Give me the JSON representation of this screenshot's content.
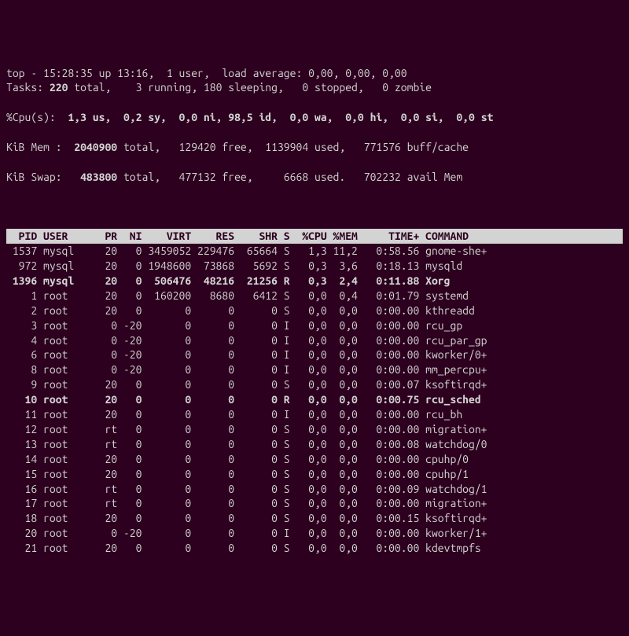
{
  "summary": {
    "line1": "top - 15:28:35 up 13:16,  1 user,  load average: 0,00, 0,00, 0,00",
    "tasks_label": "Tasks:",
    "tasks_rest": " total,    3 running, 180 sleeping,   0 stopped,   0 zombie",
    "tasks_total": " 220",
    "cpu_label": "%Cpu(s):",
    "cpu_vals": "  1,3 us,  0,2 sy,  0,0 ni, 98,5 id,  0,0 wa,  0,0 hi,  0,0 si,  0,0 st",
    "mem_label": "KiB Mem :",
    "mem_total": "  2040900 ",
    "mem_rest1": "total,   129420 free,  1139904 used,   771576 buff/cache",
    "swap_label": "KiB Swap:",
    "swap_total": "   483800 ",
    "swap_rest1": "total,   477132 free,     6668 used.   702232 avail Mem"
  },
  "columns": [
    "PID",
    "USER",
    "PR",
    "NI",
    "VIRT",
    "RES",
    "SHR",
    "S",
    "%CPU",
    "%MEM",
    "TIME+",
    "COMMAND"
  ],
  "header_line": "  PID USER      PR  NI    VIRT    RES    SHR S  %CPU %MEM     TIME+ COMMAND   ",
  "rows": [
    {
      "bold": false,
      "pid": "1537",
      "user": "mysql",
      "pr": "20",
      "ni": "0",
      "virt": "3459052",
      "res": "229476",
      "shr": "65664",
      "s": "S",
      "cpu": "1,3",
      "mem": "11,2",
      "time": "0:58.56",
      "cmd": "gnome-she+"
    },
    {
      "bold": false,
      "pid": "972",
      "user": "mysql",
      "pr": "20",
      "ni": "0",
      "virt": "1948600",
      "res": "73868",
      "shr": "5692",
      "s": "S",
      "cpu": "0,3",
      "mem": "3,6",
      "time": "0:18.13",
      "cmd": "mysqld"
    },
    {
      "bold": true,
      "pid": "1396",
      "user": "mysql",
      "pr": "20",
      "ni": "0",
      "virt": "506476",
      "res": "48216",
      "shr": "21256",
      "s": "R",
      "cpu": "0,3",
      "mem": "2,4",
      "time": "0:11.88",
      "cmd": "Xorg"
    },
    {
      "bold": false,
      "pid": "1",
      "user": "root",
      "pr": "20",
      "ni": "0",
      "virt": "160200",
      "res": "8680",
      "shr": "6412",
      "s": "S",
      "cpu": "0,0",
      "mem": "0,4",
      "time": "0:01.79",
      "cmd": "systemd"
    },
    {
      "bold": false,
      "pid": "2",
      "user": "root",
      "pr": "20",
      "ni": "0",
      "virt": "0",
      "res": "0",
      "shr": "0",
      "s": "S",
      "cpu": "0,0",
      "mem": "0,0",
      "time": "0:00.00",
      "cmd": "kthreadd"
    },
    {
      "bold": false,
      "pid": "3",
      "user": "root",
      "pr": "0",
      "ni": "-20",
      "virt": "0",
      "res": "0",
      "shr": "0",
      "s": "I",
      "cpu": "0,0",
      "mem": "0,0",
      "time": "0:00.00",
      "cmd": "rcu_gp"
    },
    {
      "bold": false,
      "pid": "4",
      "user": "root",
      "pr": "0",
      "ni": "-20",
      "virt": "0",
      "res": "0",
      "shr": "0",
      "s": "I",
      "cpu": "0,0",
      "mem": "0,0",
      "time": "0:00.00",
      "cmd": "rcu_par_gp"
    },
    {
      "bold": false,
      "pid": "6",
      "user": "root",
      "pr": "0",
      "ni": "-20",
      "virt": "0",
      "res": "0",
      "shr": "0",
      "s": "I",
      "cpu": "0,0",
      "mem": "0,0",
      "time": "0:00.00",
      "cmd": "kworker/0+"
    },
    {
      "bold": false,
      "pid": "8",
      "user": "root",
      "pr": "0",
      "ni": "-20",
      "virt": "0",
      "res": "0",
      "shr": "0",
      "s": "I",
      "cpu": "0,0",
      "mem": "0,0",
      "time": "0:00.00",
      "cmd": "mm_percpu+"
    },
    {
      "bold": false,
      "pid": "9",
      "user": "root",
      "pr": "20",
      "ni": "0",
      "virt": "0",
      "res": "0",
      "shr": "0",
      "s": "S",
      "cpu": "0,0",
      "mem": "0,0",
      "time": "0:00.07",
      "cmd": "ksoftirqd+"
    },
    {
      "bold": true,
      "pid": "10",
      "user": "root",
      "pr": "20",
      "ni": "0",
      "virt": "0",
      "res": "0",
      "shr": "0",
      "s": "R",
      "cpu": "0,0",
      "mem": "0,0",
      "time": "0:00.75",
      "cmd": "rcu_sched"
    },
    {
      "bold": false,
      "pid": "11",
      "user": "root",
      "pr": "20",
      "ni": "0",
      "virt": "0",
      "res": "0",
      "shr": "0",
      "s": "I",
      "cpu": "0,0",
      "mem": "0,0",
      "time": "0:00.00",
      "cmd": "rcu_bh"
    },
    {
      "bold": false,
      "pid": "12",
      "user": "root",
      "pr": "rt",
      "ni": "0",
      "virt": "0",
      "res": "0",
      "shr": "0",
      "s": "S",
      "cpu": "0,0",
      "mem": "0,0",
      "time": "0:00.00",
      "cmd": "migration+"
    },
    {
      "bold": false,
      "pid": "13",
      "user": "root",
      "pr": "rt",
      "ni": "0",
      "virt": "0",
      "res": "0",
      "shr": "0",
      "s": "S",
      "cpu": "0,0",
      "mem": "0,0",
      "time": "0:00.08",
      "cmd": "watchdog/0"
    },
    {
      "bold": false,
      "pid": "14",
      "user": "root",
      "pr": "20",
      "ni": "0",
      "virt": "0",
      "res": "0",
      "shr": "0",
      "s": "S",
      "cpu": "0,0",
      "mem": "0,0",
      "time": "0:00.00",
      "cmd": "cpuhp/0"
    },
    {
      "bold": false,
      "pid": "15",
      "user": "root",
      "pr": "20",
      "ni": "0",
      "virt": "0",
      "res": "0",
      "shr": "0",
      "s": "S",
      "cpu": "0,0",
      "mem": "0,0",
      "time": "0:00.00",
      "cmd": "cpuhp/1"
    },
    {
      "bold": false,
      "pid": "16",
      "user": "root",
      "pr": "rt",
      "ni": "0",
      "virt": "0",
      "res": "0",
      "shr": "0",
      "s": "S",
      "cpu": "0,0",
      "mem": "0,0",
      "time": "0:00.09",
      "cmd": "watchdog/1"
    },
    {
      "bold": false,
      "pid": "17",
      "user": "root",
      "pr": "rt",
      "ni": "0",
      "virt": "0",
      "res": "0",
      "shr": "0",
      "s": "S",
      "cpu": "0,0",
      "mem": "0,0",
      "time": "0:00.00",
      "cmd": "migration+"
    },
    {
      "bold": false,
      "pid": "18",
      "user": "root",
      "pr": "20",
      "ni": "0",
      "virt": "0",
      "res": "0",
      "shr": "0",
      "s": "S",
      "cpu": "0,0",
      "mem": "0,0",
      "time": "0:00.15",
      "cmd": "ksoftirqd+"
    },
    {
      "bold": false,
      "pid": "20",
      "user": "root",
      "pr": "0",
      "ni": "-20",
      "virt": "0",
      "res": "0",
      "shr": "0",
      "s": "I",
      "cpu": "0,0",
      "mem": "0,0",
      "time": "0:00.00",
      "cmd": "kworker/1+"
    },
    {
      "bold": false,
      "pid": "21",
      "user": "root",
      "pr": "20",
      "ni": "0",
      "virt": "0",
      "res": "0",
      "shr": "0",
      "s": "S",
      "cpu": "0,0",
      "mem": "0,0",
      "time": "0:00.00",
      "cmd": "kdevtmpfs"
    }
  ]
}
